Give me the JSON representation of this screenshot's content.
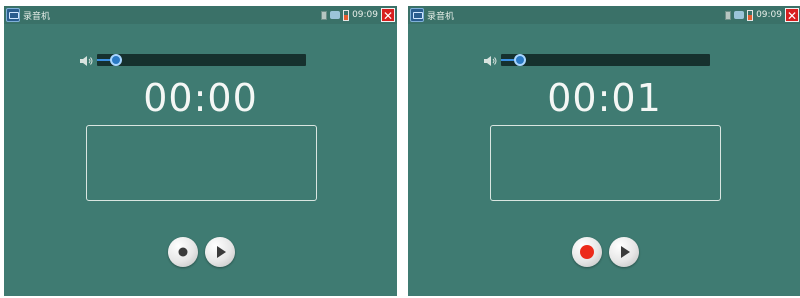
{
  "screens": [
    {
      "app_title": "录音机",
      "clock": "09:09",
      "volume_percent": 9,
      "timer": "00:00",
      "recording": false,
      "icons": [
        "app-icon",
        "sim-icon",
        "network-icon",
        "battery-icon",
        "close-icon",
        "speaker-icon",
        "record-icon",
        "play-icon"
      ],
      "close_glyph": "✕"
    },
    {
      "app_title": "录音机",
      "clock": "09:09",
      "volume_percent": 9,
      "timer": "00:01",
      "recording": true,
      "icons": [
        "app-icon",
        "sim-icon",
        "network-icon",
        "battery-icon",
        "close-icon",
        "speaker-icon",
        "record-icon",
        "play-icon"
      ],
      "close_glyph": "✕"
    }
  ],
  "colors": {
    "background": "#3f7b72",
    "status_bar": "#3a7168",
    "record_active": "#ec2a1a",
    "record_idle": "#3a3a3a",
    "close": "#d81f1f"
  }
}
